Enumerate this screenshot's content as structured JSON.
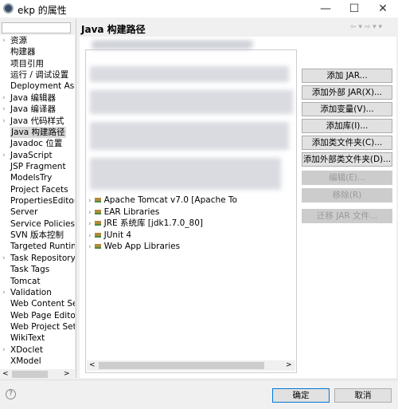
{
  "window": {
    "title": "ekp 的属性",
    "minimize": "—",
    "maximize": "☐",
    "close": "✕"
  },
  "sidebar": {
    "filter_value": "",
    "items": [
      {
        "label": "资源",
        "expandable": true
      },
      {
        "label": "构建器"
      },
      {
        "label": "项目引用"
      },
      {
        "label": "运行 / 调试设置"
      },
      {
        "label": "Deployment Assembly"
      },
      {
        "label": "Java 编辑器",
        "expandable": true
      },
      {
        "label": "Java 编译器",
        "expandable": true
      },
      {
        "label": "Java 代码样式",
        "expandable": true
      },
      {
        "label": "Java 构建路径",
        "selected": true
      },
      {
        "label": "Javadoc 位置"
      },
      {
        "label": "JavaScript",
        "expandable": true
      },
      {
        "label": "JSP Fragment"
      },
      {
        "label": "ModelsTry"
      },
      {
        "label": "Project Facets"
      },
      {
        "label": "PropertiesEditor"
      },
      {
        "label": "Server"
      },
      {
        "label": "Service Policies"
      },
      {
        "label": "SVN 版本控制"
      },
      {
        "label": "Targeted Runtimes"
      },
      {
        "label": "Task Repository",
        "expandable": true
      },
      {
        "label": "Task Tags"
      },
      {
        "label": "Tomcat"
      },
      {
        "label": "Validation",
        "expandable": true
      },
      {
        "label": "Web Content Settings"
      },
      {
        "label": "Web Page Editor"
      },
      {
        "label": "Web Project Settings"
      },
      {
        "label": "WikiText"
      },
      {
        "label": "XDoclet",
        "expandable": true
      },
      {
        "label": "XModel"
      }
    ]
  },
  "page": {
    "title": "Java 构建路径",
    "nav_icons": "⇦ ▾ ⇨ ▾ ▾"
  },
  "tree": {
    "items": [
      "Apache Tomcat v7.0 [Apache To",
      "EAR Libraries",
      "JRE 系统库 [jdk1.7.0_80]",
      "JUnit 4",
      "Web App Libraries"
    ]
  },
  "buttons": [
    {
      "label": "添加 JAR...",
      "enabled": true
    },
    {
      "label": "添加外部 JAR(X)...",
      "enabled": true
    },
    {
      "label": "添加变量(V)...",
      "enabled": true
    },
    {
      "label": "添加库(I)...",
      "enabled": true
    },
    {
      "label": "添加类文件夹(C)...",
      "enabled": true
    },
    {
      "label": "添加外部类文件夹(D)...",
      "enabled": true
    },
    {
      "label": "编辑(E)...",
      "enabled": false
    },
    {
      "label": "移除(R)",
      "enabled": false
    },
    {
      "label": "迁移 JAR 文件...",
      "enabled": false
    }
  ],
  "footer": {
    "help": "?",
    "ok": "确定",
    "cancel": "取消"
  },
  "scroll": {
    "left": "<",
    "right": ">"
  }
}
